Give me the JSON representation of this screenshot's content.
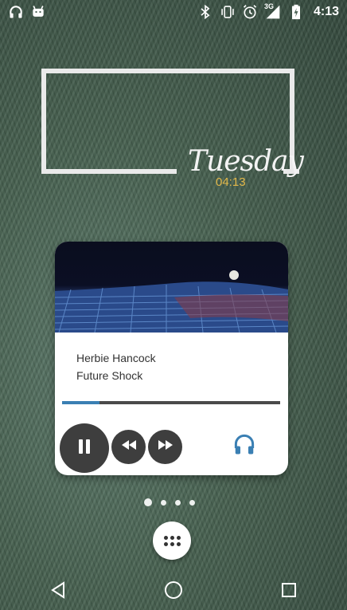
{
  "status_bar": {
    "left_icons": [
      "headphones-icon",
      "android-icon"
    ],
    "right_icons": [
      "bluetooth-icon",
      "vibrate-icon",
      "alarm-icon",
      "signal-3g-icon",
      "battery-charging-icon"
    ],
    "network_label": "3G",
    "time": "4:13"
  },
  "clock_widget": {
    "day": "Tuesday",
    "time": "04:13"
  },
  "player": {
    "artist": "Herbie Hancock",
    "title": "Future Shock",
    "progress": 0.17,
    "accent_color": "#3a7fb3",
    "controls": [
      "pause-icon",
      "rewind-icon",
      "fast-forward-icon",
      "headphones-icon"
    ]
  },
  "home": {
    "page_count": 4,
    "active_page": 1
  },
  "nav_bar": {
    "buttons": [
      "back-icon",
      "home-icon",
      "recents-icon"
    ]
  }
}
